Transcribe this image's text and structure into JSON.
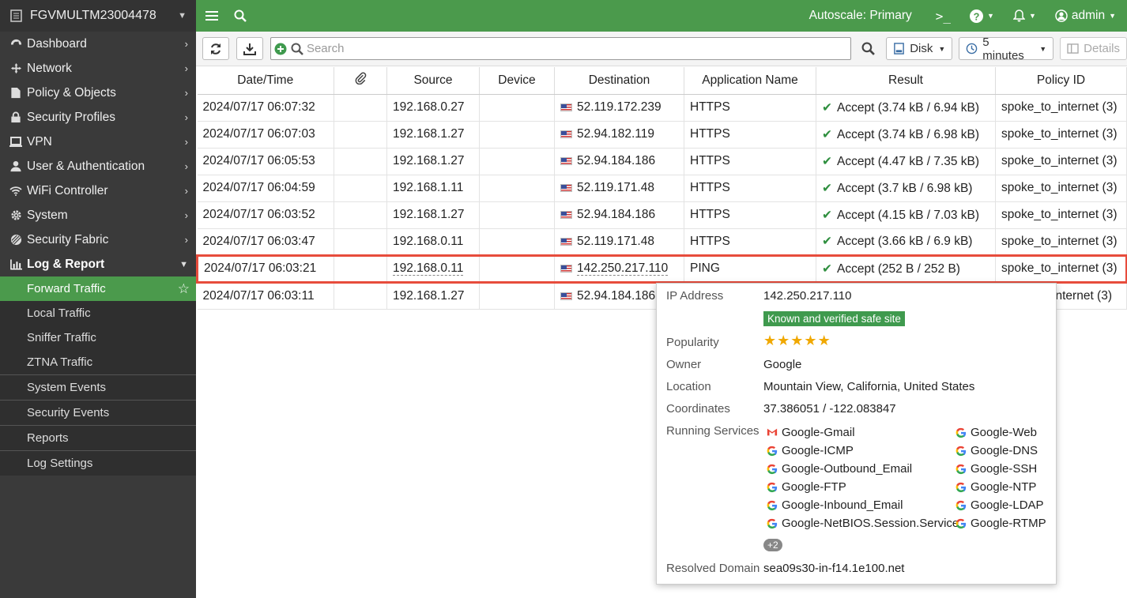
{
  "sidebar": {
    "device_name": "FGVMULTM23004478",
    "nav": [
      {
        "label": "Dashboard",
        "icon": "dashboard-icon"
      },
      {
        "label": "Network",
        "icon": "network-icon"
      },
      {
        "label": "Policy & Objects",
        "icon": "policy-icon"
      },
      {
        "label": "Security Profiles",
        "icon": "lock-icon"
      },
      {
        "label": "VPN",
        "icon": "vpn-icon"
      },
      {
        "label": "User & Authentication",
        "icon": "user-icon"
      },
      {
        "label": "WiFi Controller",
        "icon": "wifi-icon"
      },
      {
        "label": "System",
        "icon": "gear-icon"
      },
      {
        "label": "Security Fabric",
        "icon": "fabric-icon"
      },
      {
        "label": "Log & Report",
        "icon": "chart-icon"
      }
    ],
    "sub": [
      "Forward Traffic",
      "Local Traffic",
      "Sniffer Traffic",
      "ZTNA Traffic",
      "System Events",
      "Security Events",
      "Reports",
      "Log Settings"
    ]
  },
  "topbar": {
    "autoscale": "Autoscale: Primary",
    "admin": "admin"
  },
  "toolbar": {
    "search_placeholder": "Search",
    "disk": "Disk",
    "time": "5 minutes",
    "details": "Details"
  },
  "table": {
    "headers": [
      "Date/Time",
      "",
      "Source",
      "Device",
      "Destination",
      "Application Name",
      "Result",
      "Policy ID"
    ],
    "rows": [
      {
        "time": "2024/07/17 06:07:32",
        "source": "192.168.0.27",
        "dest": "52.119.172.239",
        "app": "HTTPS",
        "result": "Accept (3.74 kB / 6.94 kB)",
        "policy": "spoke_to_internet (3)"
      },
      {
        "time": "2024/07/17 06:07:03",
        "source": "192.168.1.27",
        "dest": "52.94.182.119",
        "app": "HTTPS",
        "result": "Accept (3.74 kB / 6.98 kB)",
        "policy": "spoke_to_internet (3)"
      },
      {
        "time": "2024/07/17 06:05:53",
        "source": "192.168.1.27",
        "dest": "52.94.184.186",
        "app": "HTTPS",
        "result": "Accept (4.47 kB / 7.35 kB)",
        "policy": "spoke_to_internet (3)"
      },
      {
        "time": "2024/07/17 06:04:59",
        "source": "192.168.1.11",
        "dest": "52.119.171.48",
        "app": "HTTPS",
        "result": "Accept (3.7 kB / 6.98 kB)",
        "policy": "spoke_to_internet (3)"
      },
      {
        "time": "2024/07/17 06:03:52",
        "source": "192.168.1.27",
        "dest": "52.94.184.186",
        "app": "HTTPS",
        "result": "Accept (4.15 kB / 7.03 kB)",
        "policy": "spoke_to_internet (3)"
      },
      {
        "time": "2024/07/17 06:03:47",
        "source": "192.168.0.11",
        "dest": "52.119.171.48",
        "app": "HTTPS",
        "result": "Accept (3.66 kB / 6.9 kB)",
        "policy": "spoke_to_internet (3)"
      },
      {
        "time": "2024/07/17 06:03:21",
        "source": "192.168.0.11",
        "dest": "142.250.217.110",
        "app": "PING",
        "result": "Accept (252 B / 252 B)",
        "policy": "spoke_to_internet (3)"
      },
      {
        "time": "2024/07/17 06:03:11",
        "source": "192.168.1.27",
        "dest": "52.94.184.186",
        "app": "",
        "result": "",
        "policy": "internet (3)"
      }
    ]
  },
  "tooltip": {
    "ip_label": "IP Address",
    "ip": "142.250.217.110",
    "safe_badge": "Known and verified safe site",
    "popularity_label": "Popularity",
    "popularity_stars": 5,
    "owner_label": "Owner",
    "owner": "Google",
    "location_label": "Location",
    "location": "Mountain View, California, United States",
    "coords_label": "Coordinates",
    "coords": "37.386051 / -122.083847",
    "services_label": "Running Services",
    "services_left": [
      "Google-Gmail",
      "Google-ICMP",
      "Google-Outbound_Email",
      "Google-FTP",
      "Google-Inbound_Email",
      "Google-NetBIOS.Session.Service"
    ],
    "services_right": [
      "Google-Web",
      "Google-DNS",
      "Google-SSH",
      "Google-NTP",
      "Google-LDAP",
      "Google-RTMP"
    ],
    "more": "+2",
    "domain_label": "Resolved Domain",
    "domain": "sea09s30-in-f14.1e100.net"
  }
}
